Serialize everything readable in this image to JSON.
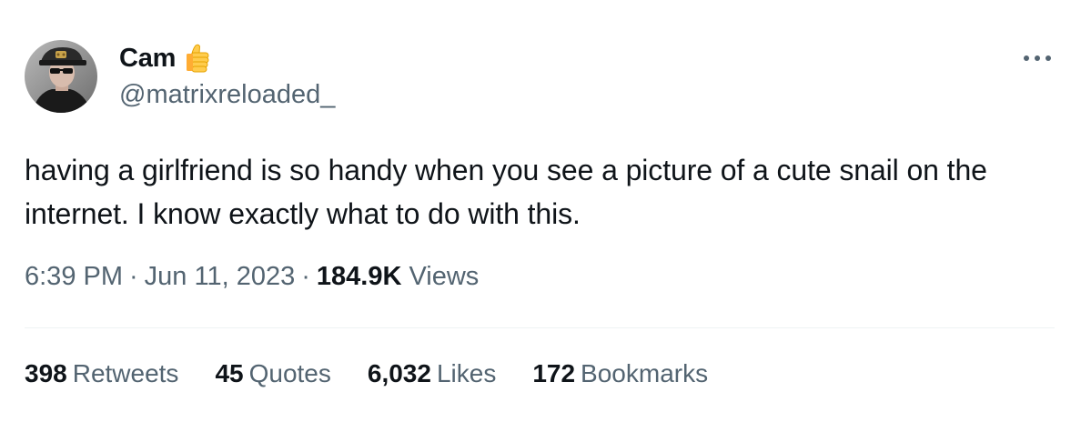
{
  "author": {
    "display_name": "Cam",
    "emoji": "👍",
    "handle": "@matrixreloaded_"
  },
  "tweet": {
    "text": "having a girlfriend is so handy when you see a picture of a cute snail on the internet. I know exactly what to do with this."
  },
  "meta": {
    "time": "6:39 PM",
    "separator": "·",
    "date": "Jun 11, 2023",
    "views_count": "184.9K",
    "views_label": "Views"
  },
  "stats": [
    {
      "count": "398",
      "label": "Retweets"
    },
    {
      "count": "45",
      "label": "Quotes"
    },
    {
      "count": "6,032",
      "label": "Likes"
    },
    {
      "count": "172",
      "label": "Bookmarks"
    }
  ],
  "colors": {
    "primary_text": "#0f1419",
    "secondary_text": "#536471",
    "divider": "#eff3f4"
  },
  "icons": {
    "more": "more-dots-icon",
    "emoji": "thumbs-up-icon"
  }
}
